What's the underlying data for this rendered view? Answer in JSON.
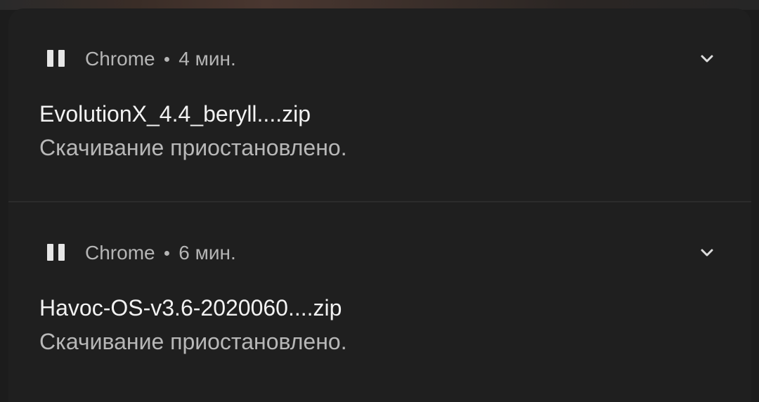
{
  "notifications": [
    {
      "app": "Chrome",
      "separator": "●",
      "time": "4 мин.",
      "title": "EvolutionX_4.4_beryll....zip",
      "status": "Скачивание приостановлено.",
      "icon": "pause-icon",
      "expand_icon": "chevron-down-icon"
    },
    {
      "app": "Chrome",
      "separator": "●",
      "time": "6 мин.",
      "title": "Havoc-OS-v3.6-2020060....zip",
      "status": "Скачивание приостановлено.",
      "icon": "pause-icon",
      "expand_icon": "chevron-down-icon"
    }
  ],
  "colors": {
    "background": "#1f1f1f",
    "title_text": "#f2f2f2",
    "secondary_text": "#b8b8b8",
    "divider": "#2c2c2c"
  }
}
